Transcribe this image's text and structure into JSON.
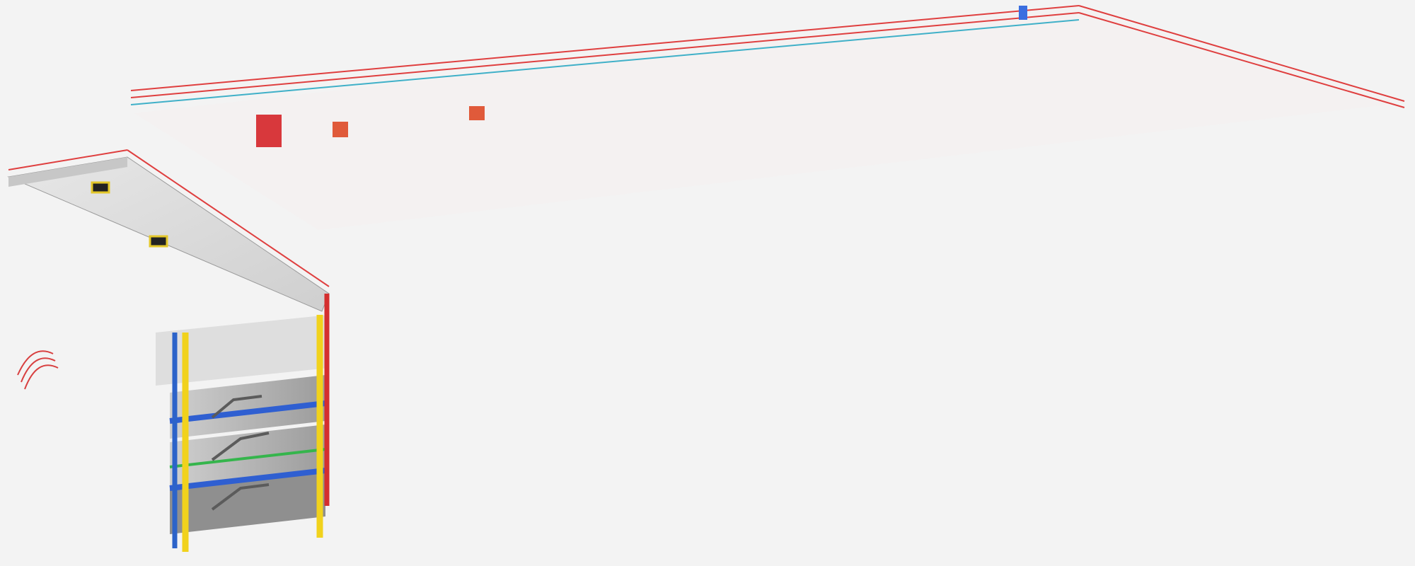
{
  "image": {
    "subject": "steel-frame-structure-3d-model"
  },
  "colors": {
    "background": "#f3f3f3",
    "column_red": "#d42f2f",
    "beam_blue": "#2f5fd1",
    "bracing_green": "#35b54c",
    "column_yellow": "#f1d21c",
    "rail_cyan": "#5fd5e5",
    "slab_grey": "#dcdcdc"
  }
}
